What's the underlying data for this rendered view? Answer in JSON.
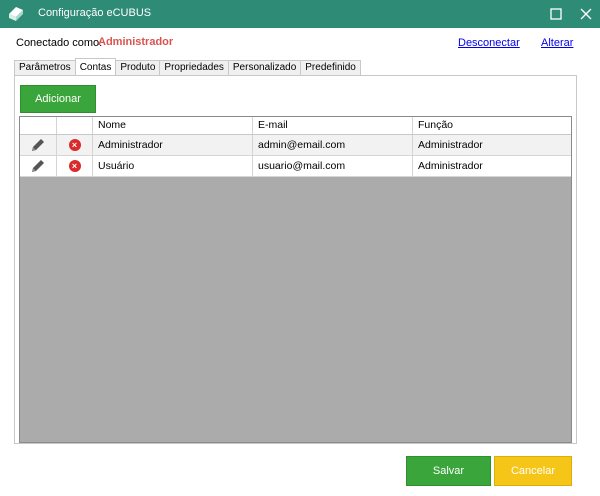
{
  "window": {
    "title": "Configuração eCUBUS",
    "icons": {
      "logo": "ecubus-logo",
      "maximize": "maximize-icon",
      "close": "close-icon"
    }
  },
  "header": {
    "connected_label": "Conectado como:",
    "connected_user": "Administrador",
    "disconnect_link": "Desconectar",
    "change_link": "Alterar"
  },
  "tabs": [
    {
      "label": "Parâmetros",
      "active": false
    },
    {
      "label": "Contas",
      "active": true
    },
    {
      "label": "Produto",
      "active": false
    },
    {
      "label": "Propriedades",
      "active": false
    },
    {
      "label": "Personalizado",
      "active": false
    },
    {
      "label": "Predefinido",
      "active": false
    }
  ],
  "accounts": {
    "add_button": "Adicionar",
    "columns": [
      "Nome",
      "E-mail",
      "Função"
    ],
    "rows": [
      {
        "name": "Administrador",
        "email": "admin@email.com",
        "role": "Administrador"
      },
      {
        "name": "Usuário",
        "email": "usuario@mail.com",
        "role": "Administrador"
      }
    ]
  },
  "footer": {
    "save_button": "Salvar",
    "cancel_button": "Cancelar"
  },
  "colors": {
    "titlebar": "#2e8b76",
    "primary_button": "#3aa53a",
    "cancel_button": "#f5c518",
    "delete_icon": "#d92b2b",
    "connected_user": "#d9534f",
    "grid_background": "#ababab"
  }
}
